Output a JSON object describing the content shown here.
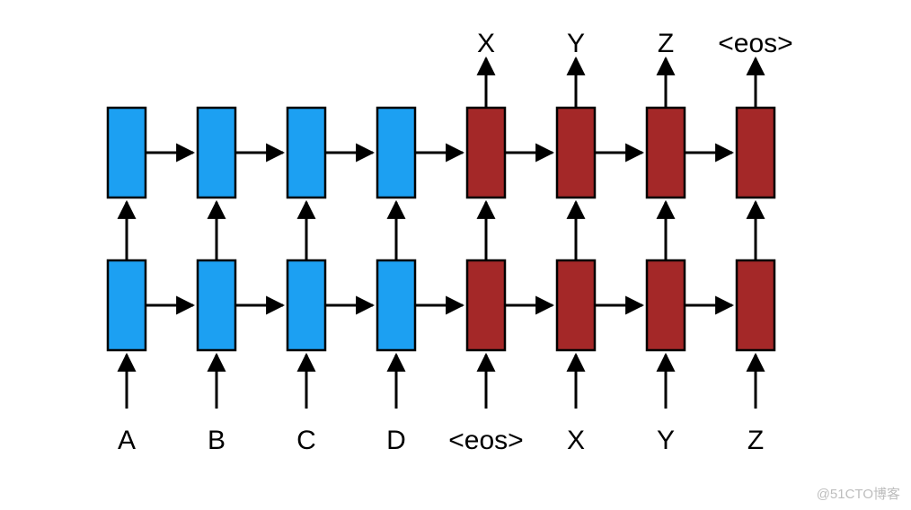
{
  "diagram": {
    "encoder_color": "#1ca0f2",
    "decoder_color": "#a42828",
    "inputs": [
      "A",
      "B",
      "C",
      "D",
      "<eos>",
      "X",
      "Y",
      "Z"
    ],
    "outputs": [
      "",
      "",
      "",
      "",
      "X",
      "Y",
      "Z",
      "<eos>"
    ],
    "cell_types": [
      "encoder",
      "encoder",
      "encoder",
      "encoder",
      "decoder",
      "decoder",
      "decoder",
      "decoder"
    ]
  },
  "watermark": "@51CTO博客"
}
